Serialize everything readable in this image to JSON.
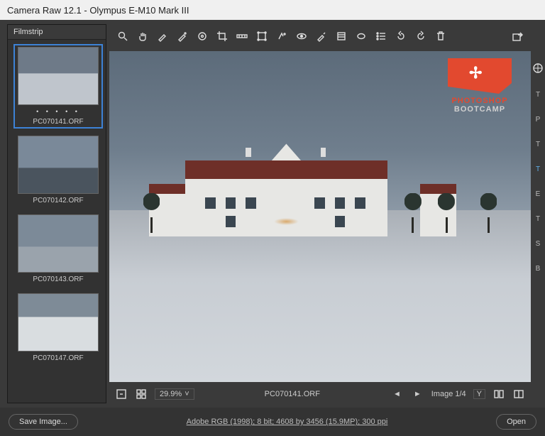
{
  "title": "Camera Raw 12.1  -  Olympus E-M10 Mark III",
  "filmstrip": {
    "heading": "Filmstrip",
    "items": [
      {
        "label": "PC070141.ORF"
      },
      {
        "label": "PC070142.ORF"
      },
      {
        "label": "PC070143.ORF"
      },
      {
        "label": "PC070147.ORF"
      }
    ]
  },
  "logo": {
    "line1": "PHOTOSHOP",
    "line2": "BOOTCAMP"
  },
  "status": {
    "zoom": "29.9%",
    "filename": "PC070141.ORF",
    "image_counter": "Image 1/4",
    "y_label": "Y"
  },
  "footer": {
    "save_label": "Save Image...",
    "info": "Adobe RGB (1998); 8 bit; 4608 by 3456 (15.9MP); 300 ppi",
    "open_label": "Open"
  },
  "right_tabs": [
    "T",
    "P",
    "T",
    "T",
    "E",
    "T",
    "S",
    "B"
  ]
}
